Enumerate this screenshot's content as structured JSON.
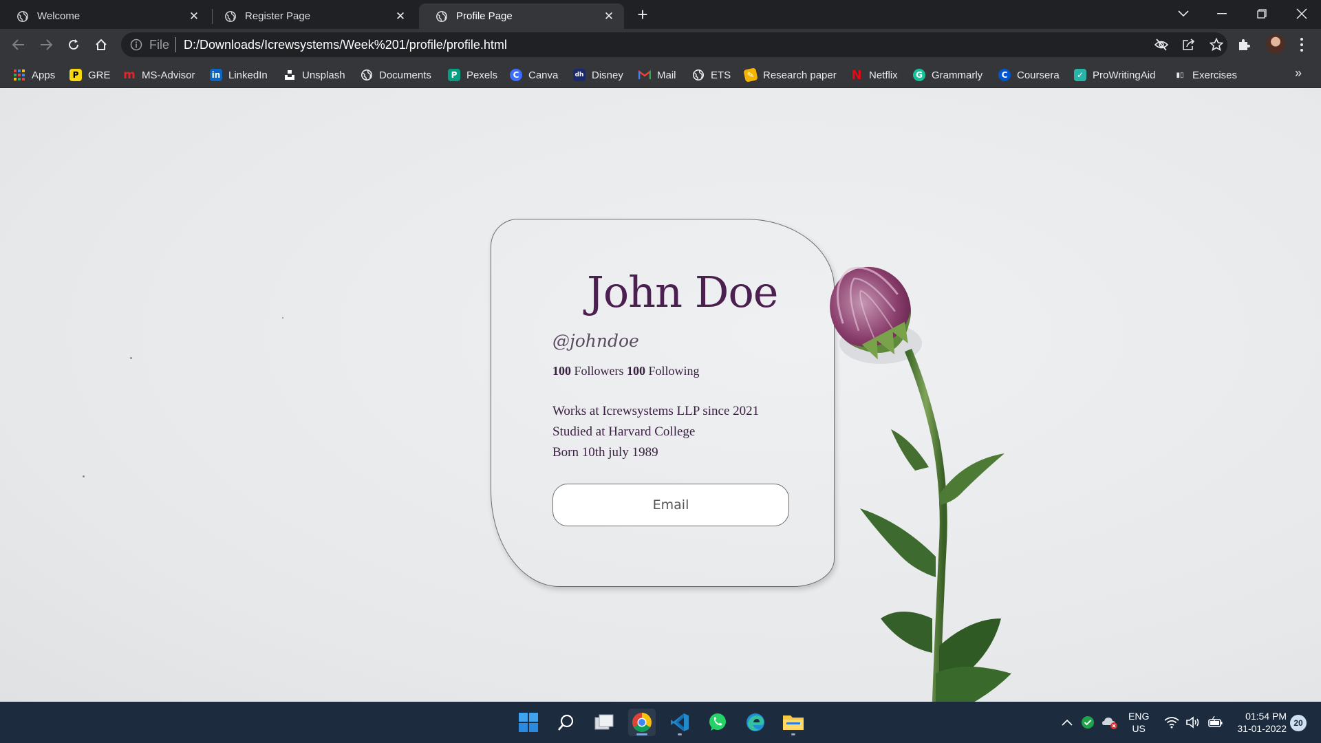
{
  "browser": {
    "tabs": [
      {
        "title": "Welcome",
        "active": false
      },
      {
        "title": "Register Page",
        "active": false
      },
      {
        "title": "Profile Page",
        "active": true
      }
    ],
    "address": {
      "scheme_label": "File",
      "url": "D:/Downloads/Icrewsystems/Week%201/profile/profile.html"
    },
    "bookmarks": [
      {
        "label": "Apps",
        "icon": "apps-grid-icon",
        "color": "#ea4335"
      },
      {
        "label": "GRE",
        "icon": "gre-p-icon",
        "color": "#f5d90a"
      },
      {
        "label": "MS-Advisor",
        "icon": "ms-advisor-m-icon",
        "color": "#e0242a"
      },
      {
        "label": "LinkedIn",
        "icon": "linkedin-icon",
        "color": "#0a66c2"
      },
      {
        "label": "Unsplash",
        "icon": "unsplash-icon",
        "color": "#ffffff"
      },
      {
        "label": "Documents",
        "icon": "globe-icon",
        "color": "#e8eaed"
      },
      {
        "label": "Pexels",
        "icon": "pexels-icon",
        "color": "#05a081"
      },
      {
        "label": "Canva",
        "icon": "canva-icon",
        "color": "#3d6fff"
      },
      {
        "label": "Disney",
        "icon": "disney-icon",
        "color": "#1a2a6c"
      },
      {
        "label": "Mail",
        "icon": "gmail-icon",
        "color": "#ea4335"
      },
      {
        "label": "ETS",
        "icon": "globe-icon",
        "color": "#e8eaed"
      },
      {
        "label": "Research paper",
        "icon": "research-icon",
        "color": "#f4b400"
      },
      {
        "label": "Netflix",
        "icon": "netflix-icon",
        "color": "#e50914"
      },
      {
        "label": "Grammarly",
        "icon": "grammarly-icon",
        "color": "#15c39a"
      },
      {
        "label": "Coursera",
        "icon": "coursera-icon",
        "color": "#0056d2"
      },
      {
        "label": "ProWritingAid",
        "icon": "prowritingaid-icon",
        "color": "#2bb3a6"
      },
      {
        "label": "Exercises",
        "icon": "exercises-icon",
        "color": "#e8eaed"
      }
    ],
    "bookmarks_more": "»"
  },
  "profile": {
    "name": "John Doe",
    "handle": "@johndoe",
    "followers_count": "100",
    "followers_label": "Followers",
    "following_count": "100",
    "following_label": "Following",
    "info": [
      "Works at Icrewsystems LLP since 2021",
      "Studied at Harvard College",
      "Born 10th july 1989"
    ],
    "email_button": "Email"
  },
  "taskbar": {
    "language": "ENG",
    "region": "US",
    "time": "01:54 PM",
    "date": "31-01-2022",
    "notifications": "20"
  },
  "colors": {
    "name_purple": "#4b1f50",
    "browser_dark": "#202124",
    "toolbar": "#35363a",
    "taskbar": "#1c2b3e"
  }
}
